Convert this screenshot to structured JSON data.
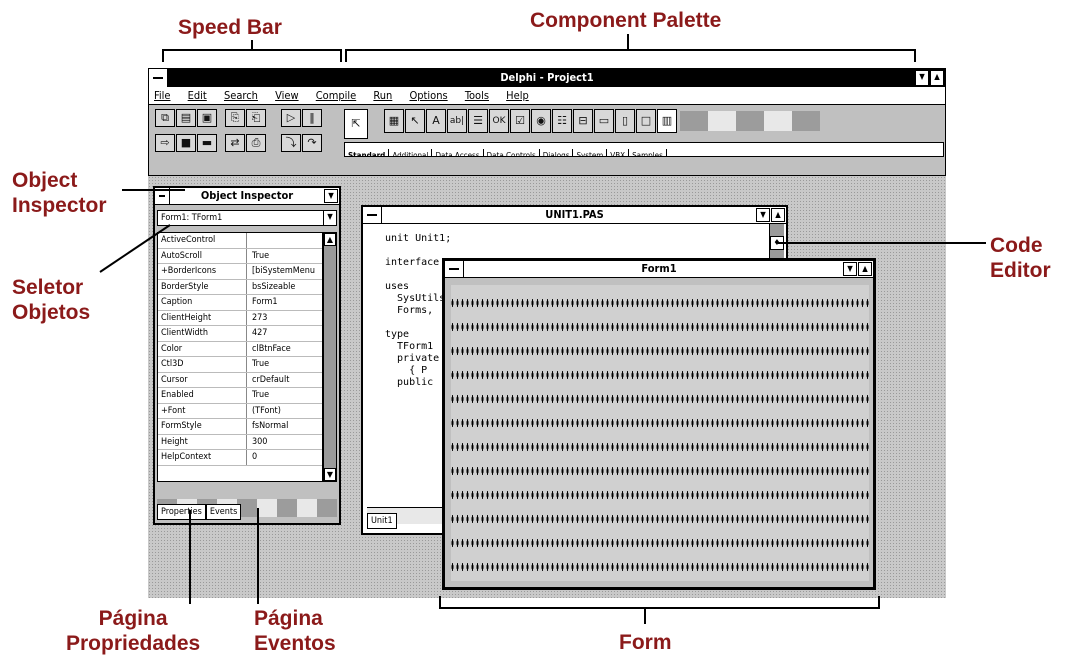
{
  "annotations": {
    "speed_bar": "Speed Bar",
    "component_palette": "Component Palette",
    "object_inspector": [
      "Object",
      "Inspector"
    ],
    "seletor_objetos": [
      "Seletor",
      "Objetos"
    ],
    "code_editor": [
      "Code",
      "Editor"
    ],
    "pagina_propriedades": [
      "Página",
      "Propriedades"
    ],
    "pagina_eventos": [
      "Página",
      "Eventos"
    ],
    "form": "Form"
  },
  "main_window": {
    "title": "Delphi - Project1",
    "menu": [
      "File",
      "Edit",
      "Search",
      "View",
      "Compile",
      "Run",
      "Options",
      "Tools",
      "Help"
    ],
    "palette_tabs": [
      "Standard",
      "Additional",
      "Data Access",
      "Data Controls",
      "Dialogs",
      "System",
      "VBX",
      "Samples"
    ]
  },
  "object_inspector": {
    "title": "Object Inspector",
    "selector_value": "Form1: TForm1",
    "properties": [
      {
        "name": "ActiveControl",
        "value": ""
      },
      {
        "name": "AutoScroll",
        "value": "True"
      },
      {
        "name": "+BorderIcons",
        "value": "[biSystemMenu"
      },
      {
        "name": "BorderStyle",
        "value": "bsSizeable"
      },
      {
        "name": "Caption",
        "value": "Form1"
      },
      {
        "name": "ClientHeight",
        "value": "273"
      },
      {
        "name": "ClientWidth",
        "value": "427"
      },
      {
        "name": "Color",
        "value": "clBtnFace"
      },
      {
        "name": "Ctl3D",
        "value": "True"
      },
      {
        "name": "Cursor",
        "value": "crDefault"
      },
      {
        "name": "Enabled",
        "value": "True"
      },
      {
        "name": "+Font",
        "value": "(TFont)"
      },
      {
        "name": "FormStyle",
        "value": "fsNormal"
      },
      {
        "name": "Height",
        "value": "300"
      },
      {
        "name": "HelpContext",
        "value": "0"
      }
    ],
    "tabs": [
      "Properties",
      "Events"
    ]
  },
  "code_editor": {
    "title": "UNIT1.PAS",
    "lines": [
      "unit Unit1;",
      "",
      "interface",
      "",
      "uses",
      "  SysUtils,",
      "  Forms,",
      "",
      "type",
      "  TForm1",
      "  private",
      "    { P",
      "  public"
    ],
    "tab": "Unit1"
  },
  "form": {
    "title": "Form1"
  }
}
